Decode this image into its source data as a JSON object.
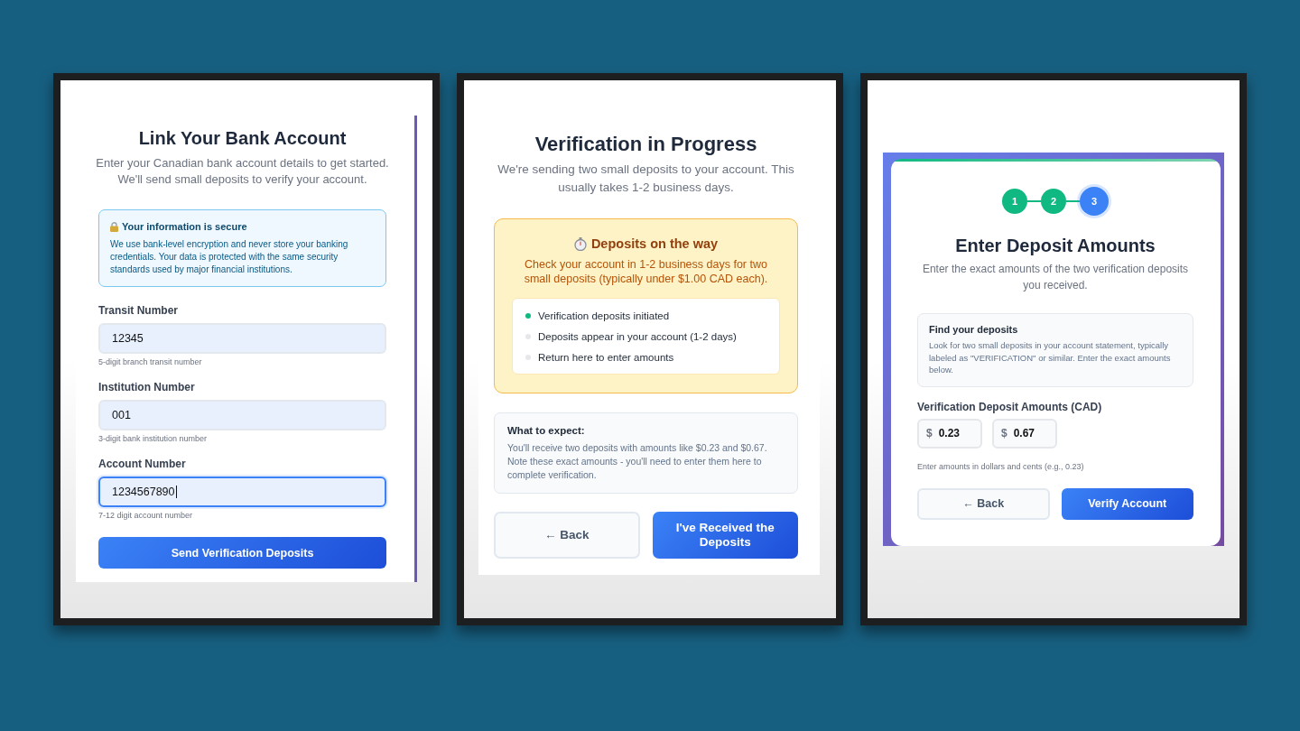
{
  "link_account": {
    "title": "Link Your Bank Account",
    "subtitle": "Enter your Canadian bank account details to get started. We'll send small deposits to verify your account.",
    "security_note": {
      "title": "Your information is secure",
      "body": "We use bank-level encryption and never store your banking credentials. Your data is protected with the same security standards used by major financial institutions."
    },
    "fields": [
      {
        "label": "Transit Number",
        "value": "12345",
        "hint": "5-digit branch transit number",
        "focused": false
      },
      {
        "label": "Institution Number",
        "value": "001",
        "hint": "3-digit bank institution number",
        "focused": false
      },
      {
        "label": "Account Number",
        "value": "1234567890",
        "hint": "7-12 digit account number",
        "focused": true
      }
    ],
    "buttons": [
      {
        "label": "Send Verification Deposits",
        "kind": "primary"
      }
    ]
  },
  "verification_progress": {
    "title": "Verification in Progress",
    "subtitle": "We're sending two small deposits to your account. This usually takes 1-2 business days.",
    "status_card": {
      "title": "Deposits on the way",
      "body": "Check your account in 1-2 business days for two small deposits (typically under $1.00 CAD each).",
      "steps": [
        {
          "label": "Verification deposits initiated",
          "done": true
        },
        {
          "label": "Deposits appear in your account (1-2 days)",
          "done": false
        },
        {
          "label": "Return here to enter amounts",
          "done": false
        }
      ]
    },
    "expectations": {
      "title": "What to expect:",
      "body": "You'll receive two deposits with amounts like $0.23 and $0.67. Note these exact amounts - you'll need to enter them here to complete verification."
    },
    "buttons": [
      {
        "label": "← Back",
        "kind": "secondary"
      },
      {
        "label": "I've Received the Deposits",
        "kind": "primary"
      }
    ]
  },
  "enter_amounts": {
    "steps": [
      {
        "label": "1",
        "completed": true,
        "current": false
      },
      {
        "label": "2",
        "completed": true,
        "current": false
      },
      {
        "label": "3",
        "completed": false,
        "current": true
      }
    ],
    "title": "Enter Deposit Amounts",
    "subtitle": "Enter the exact amounts of the two verification deposits you received.",
    "info": {
      "title": "Find your deposits",
      "body": "Look for two small deposits in your account statement, typically labeled as \"VERIFICATION\" or similar. Enter the exact amounts below."
    },
    "amounts_label": "Verification Deposit Amounts (CAD)",
    "amounts": [
      {
        "currency": "$",
        "value": "0.23"
      },
      {
        "currency": "$",
        "value": "0.67"
      }
    ],
    "hint": "Enter amounts in dollars and cents (e.g., 0.23)",
    "buttons": [
      {
        "label": "← Back",
        "kind": "secondary"
      },
      {
        "label": "Verify Account",
        "kind": "primary"
      }
    ]
  }
}
